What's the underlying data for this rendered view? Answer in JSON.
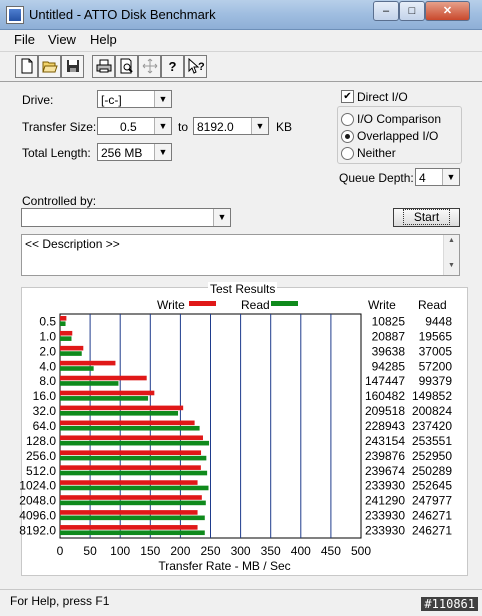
{
  "window": {
    "title": "Untitled - ATTO Disk Benchmark",
    "minimize": "–",
    "maximize": "□",
    "close": "✕"
  },
  "menu": {
    "items": [
      "File",
      "View",
      "Help"
    ]
  },
  "toolbar": {
    "icons": [
      "new-icon",
      "open-icon",
      "save-icon",
      "print-icon",
      "print-preview-icon",
      "move-icon",
      "help-icon",
      "context-help-icon"
    ]
  },
  "form": {
    "drive_label": "Drive:",
    "drive_value": "[-c-]",
    "transfer_size_label": "Transfer Size:",
    "transfer_from": "0.5",
    "to_label": "to",
    "transfer_to": "8192.0",
    "kb_label": "KB",
    "total_length_label": "Total Length:",
    "total_length_value": "256 MB",
    "controlled_by_label": "Controlled by:",
    "controlled_by_value": "",
    "direct_io_label": "Direct I/O",
    "direct_io_checked": true,
    "io_comparison_label": "I/O Comparison",
    "overlapped_io_label": "Overlapped I/O",
    "neither_label": "Neither",
    "selected_mode": "Overlapped I/O",
    "queue_depth_label": "Queue Depth:",
    "queue_depth_value": "4",
    "start_label": "Start",
    "description_text": "<< Description >>"
  },
  "chart_data": {
    "type": "bar",
    "title": "Test Results",
    "xlabel": "Transfer Rate - MB / Sec",
    "xlim": [
      0,
      500
    ],
    "xticks": [
      0,
      50,
      100,
      150,
      200,
      250,
      300,
      350,
      400,
      450,
      500
    ],
    "categories": [
      "0.5",
      "1.0",
      "2.0",
      "4.0",
      "8.0",
      "16.0",
      "32.0",
      "64.0",
      "128.0",
      "256.0",
      "512.0",
      "1024.0",
      "2048.0",
      "4096.0",
      "8192.0"
    ],
    "series": [
      {
        "name": "Write",
        "color": "#e01818",
        "values": [
          10.6,
          20.4,
          38.7,
          92.1,
          144.0,
          156.7,
          204.6,
          223.6,
          237.5,
          234.3,
          234.0,
          228.5,
          235.6,
          228.5,
          228.5
        ]
      },
      {
        "name": "Read",
        "color": "#0f8a1c",
        "values": [
          9.2,
          19.1,
          36.1,
          55.9,
          97.1,
          146.3,
          196.1,
          231.9,
          247.6,
          243.1,
          244.4,
          246.7,
          242.2,
          240.5,
          240.5
        ]
      }
    ],
    "table": {
      "write_header": "Write",
      "read_header": "Read",
      "write": [
        "10825",
        "20887",
        "39638",
        "94285",
        "147447",
        "160482",
        "209518",
        "228943",
        "243154",
        "239876",
        "239674",
        "233930",
        "241290",
        "233930",
        "233930"
      ],
      "read": [
        "9448",
        "19565",
        "37005",
        "57200",
        "99379",
        "149852",
        "200824",
        "237420",
        "253551",
        "252950",
        "250289",
        "252645",
        "247977",
        "246271",
        "246271"
      ]
    },
    "grid": true,
    "legend": "top"
  },
  "status": {
    "text": "For Help, press F1",
    "watermark": "#110861"
  }
}
